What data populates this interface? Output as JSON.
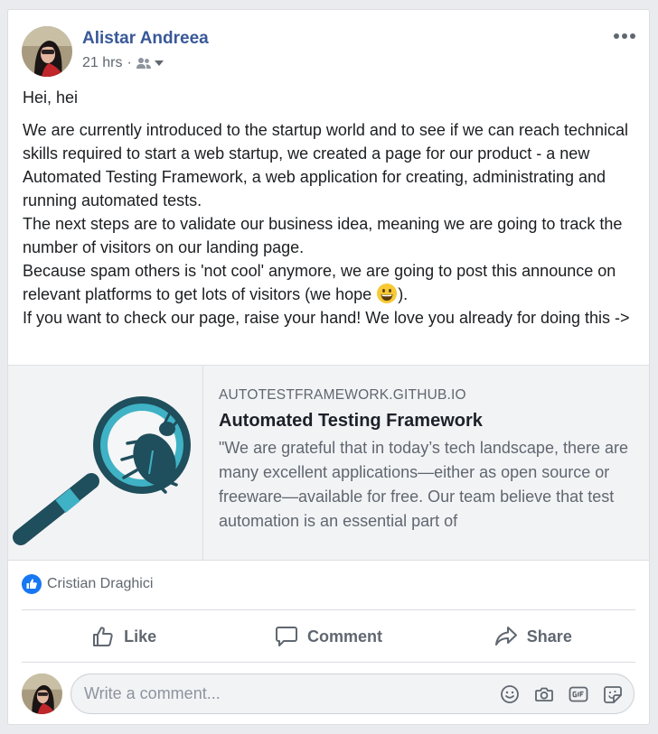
{
  "post": {
    "author": "Alistar Andreea",
    "time": "21 hrs",
    "separator": "·",
    "privacy_icon": "friends-icon",
    "greeting": "Hei, hei",
    "body_lines": [
      "We are currently introduced to the startup world and to see if we can reach technical skills required to start a web startup, we created a page for our product - a new Automated Testing Framework, a web application for creating, administrating and running automated tests.",
      "The next steps are to validate our business idea, meaning we are going to track the number of visitors on our landing page.",
      "Because spam others is 'not cool' anymore, we are going to post this announce on relevant platforms to get lots of visitors (we hope ",
      ").",
      "If you want to check our page, raise your hand! We love you already for doing this ->"
    ]
  },
  "link": {
    "domain": "AUTOTESTFRAMEWORK.GITHUB.IO",
    "title": "Automated Testing Framework",
    "description": "\"We are grateful that in today’s tech landscape, there are many excellent applications—either as open source or freeware—available for free. Our team believe that test automation is an essential part of"
  },
  "reactions": {
    "names": "Cristian Draghici"
  },
  "actions": {
    "like": "Like",
    "comment": "Comment",
    "share": "Share"
  },
  "comment_box": {
    "placeholder": "Write a comment..."
  },
  "colors": {
    "author_blue": "#385898",
    "like_blue": "#1877f2",
    "text": "#1c1e21",
    "secondary": "#606770",
    "preview_bg": "#f2f3f5"
  }
}
